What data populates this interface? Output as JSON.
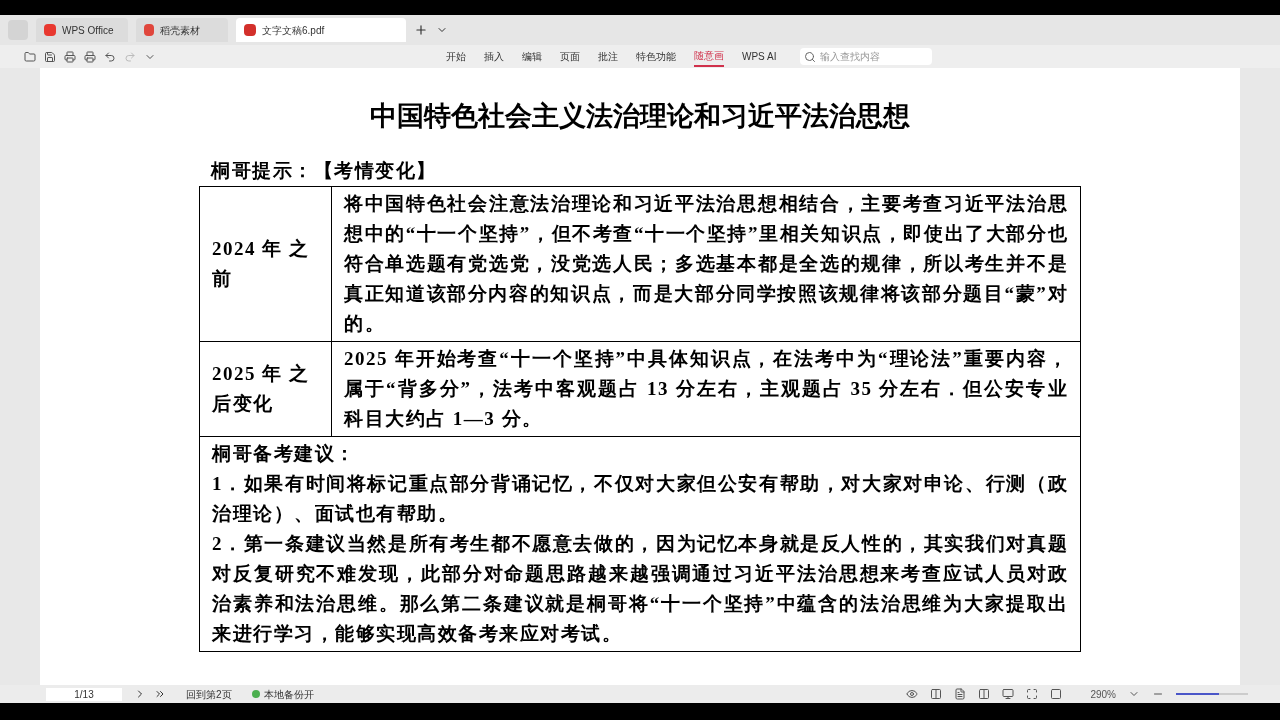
{
  "tabs": [
    {
      "label": "WPS Office",
      "kind": "wps",
      "selected": false
    },
    {
      "label": "稻壳素材",
      "kind": "docer",
      "selected": false
    },
    {
      "label": "文字文稿6.pdf",
      "kind": "pdf",
      "selected": true
    }
  ],
  "menu": [
    {
      "label": "开始",
      "selected": false
    },
    {
      "label": "插入",
      "selected": false
    },
    {
      "label": "编辑",
      "selected": false
    },
    {
      "label": "页面",
      "selected": false
    },
    {
      "label": "批注",
      "selected": false
    },
    {
      "label": "特色功能",
      "selected": false
    },
    {
      "label": "随意画",
      "selected": true
    },
    {
      "label": "WPS AI",
      "selected": false
    }
  ],
  "search": {
    "placeholder": "输入查找内容"
  },
  "document": {
    "title": "中国特色社会主义法治理论和习近平法治思想",
    "hint": "桐哥提示：【考情变化】",
    "rows": [
      {
        "label": "2024 年 之前",
        "text": "将中国特色社会注意法治理论和习近平法治思想相结合，主要考查习近平法治思想中的“十一个坚持”，但不考查“十一个坚持”里相关知识点，即使出了大部分也符合单选题有党选党，没党选人民；多选基本都是全选的规律，所以考生并不是真正知道该部分内容的知识点，而是大部分同学按照该规律将该部分题目“蒙”对的。"
      },
      {
        "label": "2025 年 之后变化",
        "text": "2025 年开始考查“十一个坚持”中具体知识点，在法考中为“理论法”重要内容，属于“背多分”，法考中客观题占 13 分左右，主观题占 35 分左右．但公安专业科目大约占 1—3 分。"
      }
    ],
    "advice_title": "桐哥备考建议：",
    "advice": [
      "1．如果有时间将标记重点部分背诵记忆，不仅对大家但公安有帮助，对大家对申论、行测（政治理论）、面试也有帮助。",
      "2．第一条建议当然是所有考生都不愿意去做的，因为记忆本身就是反人性的，其实我们对真题对反复研究不难发现，此部分对命题思路越来越强调通过习近平法治思想来考查应试人员对政治素养和法治思维。那么第二条建议就是桐哥将“十一个坚持”中蕴含的法治思维为大家提取出来进行学习，能够实现高效备考来应对考试。"
    ]
  },
  "status": {
    "page": "1/13",
    "back": "回到第2页",
    "backup": "本地备份开",
    "zoom": "290%",
    "zoom_slider": {
      "level": 0.6
    }
  }
}
